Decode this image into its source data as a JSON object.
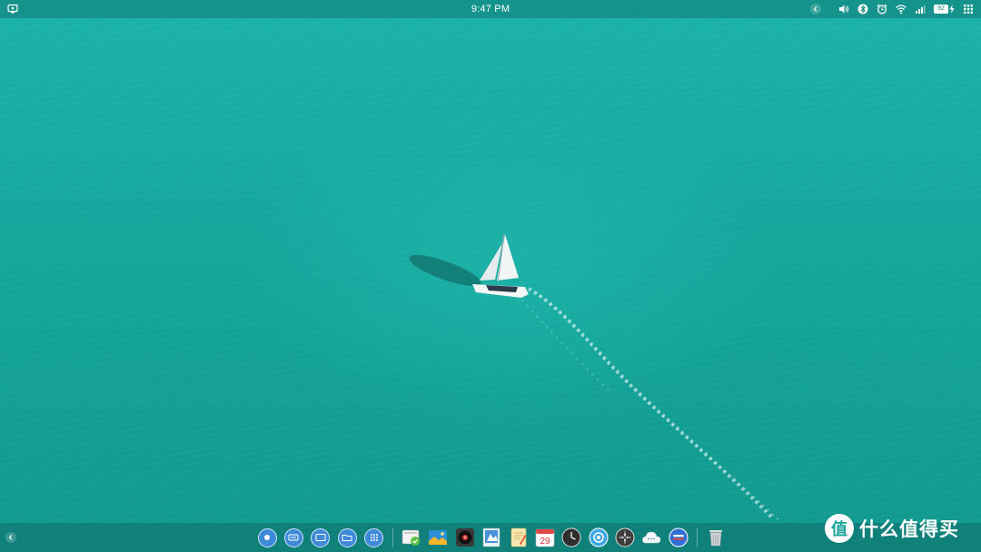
{
  "topbar": {
    "clock": "9:47 PM",
    "battery_level": "92"
  },
  "icons": {
    "launcher": "launcher-icon",
    "volume": "speaker-icon",
    "bluetooth": "bluetooth-icon",
    "alarm": "alarm-icon",
    "wifi": "wifi-icon",
    "signal": "signal-icon",
    "battery": "battery-icon",
    "apps_grid": "grid-icon"
  },
  "dock": {
    "calendar_day": "29",
    "items": [
      "launcher-button",
      "multitask-button",
      "desktop-button",
      "file-manager-button",
      "app-grid-button",
      "files-app",
      "image-viewer-app",
      "music-player-app",
      "photo-app",
      "notes-app",
      "calendar-app",
      "clock-app",
      "browser-app",
      "settings-app",
      "cloud-app",
      "message-app",
      "trash-app"
    ]
  },
  "watermark": {
    "logo_char": "值",
    "text": "什么值得买"
  },
  "colors": {
    "sea": "#15a69c",
    "bar": "#0e7872",
    "accent_blue": "#3f8ad8"
  }
}
